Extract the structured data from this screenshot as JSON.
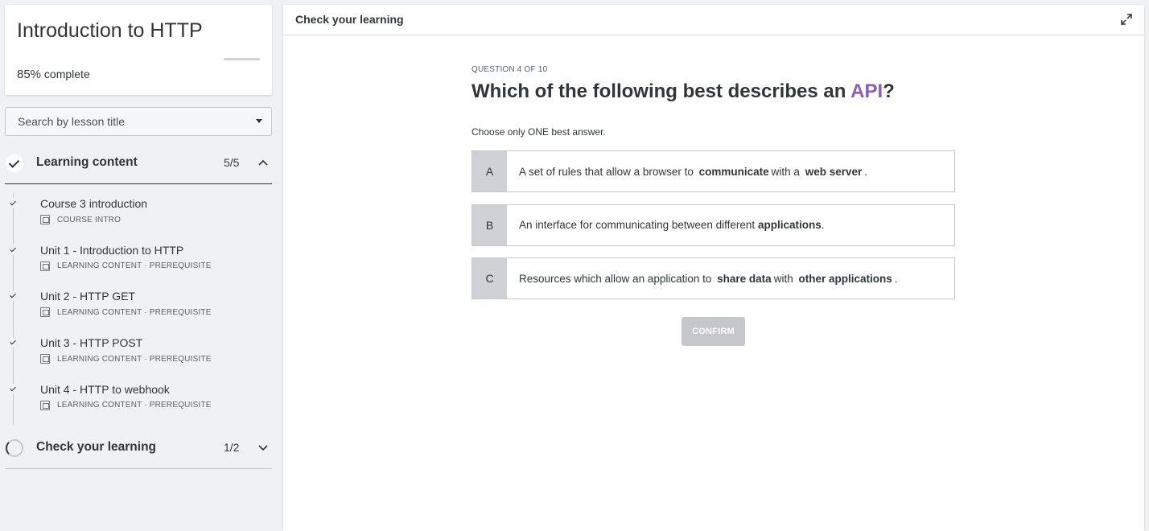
{
  "course": {
    "title": "Introduction to HTTP",
    "percent": "85%",
    "complete_label": "complete",
    "progress_fraction": 0.85
  },
  "search": {
    "placeholder": "Search by lesson title"
  },
  "learning_section": {
    "label": "Learning content",
    "count": "5/5"
  },
  "lessons": [
    {
      "title": "Course 3 introduction",
      "meta": "COURSE INTRO"
    },
    {
      "title": "Unit 1 - Introduction to HTTP",
      "meta": "LEARNING CONTENT · PREREQUISITE"
    },
    {
      "title": "Unit 2 - HTTP GET",
      "meta": "LEARNING CONTENT · PREREQUISITE"
    },
    {
      "title": "Unit 3 - HTTP POST",
      "meta": "LEARNING CONTENT · PREREQUISITE"
    },
    {
      "title": "Unit 4 - HTTP to webhook",
      "meta": "LEARNING CONTENT · PREREQUISITE"
    }
  ],
  "check_section": {
    "label": "Check your learning",
    "count": "1/2"
  },
  "topbar": {
    "title": "Check your learning"
  },
  "quiz": {
    "question_number": "QUESTION 4 OF 10",
    "question_pre": "Which of the following best describes an ",
    "question_highlight": "API",
    "question_post": "?",
    "instruction": "Choose only ONE best answer.",
    "answers": [
      {
        "letter": "A",
        "t1": "A set of rules that allow a browser to",
        "b1": "communicate",
        "t2": "with a",
        "b2": "web server",
        "t3": "."
      },
      {
        "letter": "B",
        "t1": "An interface for communicating between different",
        "b1": "applications",
        "t2": "",
        "b2": "",
        "t3": "."
      },
      {
        "letter": "C",
        "t1": "Resources which allow an application to",
        "b1": "share data",
        "t2": "with",
        "b2": "other applications",
        "t3": "."
      }
    ],
    "confirm_label": "CONFIRM"
  },
  "colors": {
    "accent": "#8d5cb5",
    "text": "#313537",
    "background": "#f0f1f3"
  }
}
